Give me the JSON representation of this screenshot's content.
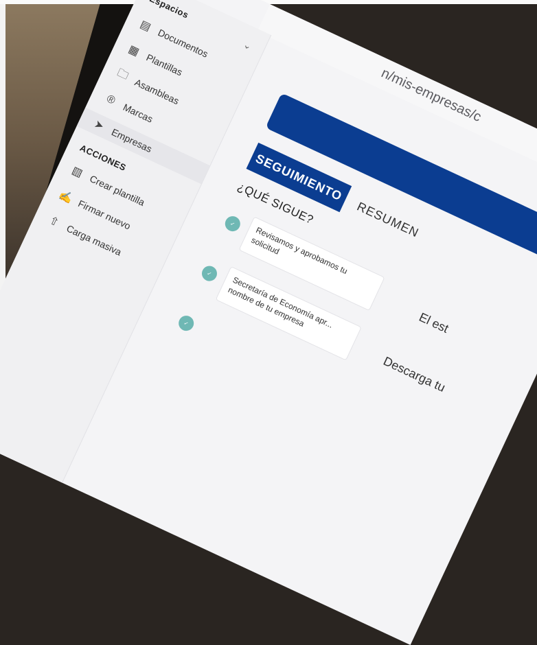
{
  "browser": {
    "url_fragment": "n/mis-empresas/c"
  },
  "sidebar": {
    "title": "Espacios",
    "items": [
      {
        "label": "Documentos",
        "icon": "document-icon"
      },
      {
        "label": "Plantillas",
        "icon": "template-icon"
      },
      {
        "label": "Asambleas",
        "icon": "folder-icon"
      },
      {
        "label": "Marcas",
        "icon": "trademark-icon"
      },
      {
        "label": "Empresas",
        "icon": "rocket-icon",
        "active": true
      }
    ],
    "actions_heading": "ACCIONES",
    "actions": [
      {
        "label": "Crear plantilla",
        "icon": "create-template-icon"
      },
      {
        "label": "Firmar nuevo",
        "icon": "sign-document-icon"
      },
      {
        "label": "Carga masiva",
        "icon": "bulk-upload-icon"
      }
    ]
  },
  "main": {
    "tabs": [
      {
        "label": "SEGUIMIENTO",
        "active": true
      },
      {
        "label": "RESUMEN",
        "active": false
      }
    ],
    "section_title": "¿QUÉ SIGUE?",
    "steps": [
      {
        "text": "Revisamos y aprobamos tu solicitud"
      },
      {
        "text": "Secretaría de Economía apr... nombre de tu empresa"
      }
    ],
    "right_texts": [
      "El est",
      "Descarga tu"
    ]
  },
  "colors": {
    "primary": "#0b3d91",
    "step_dot": "#6fb8b4",
    "sidebar_bg": "#f0f0f2"
  }
}
